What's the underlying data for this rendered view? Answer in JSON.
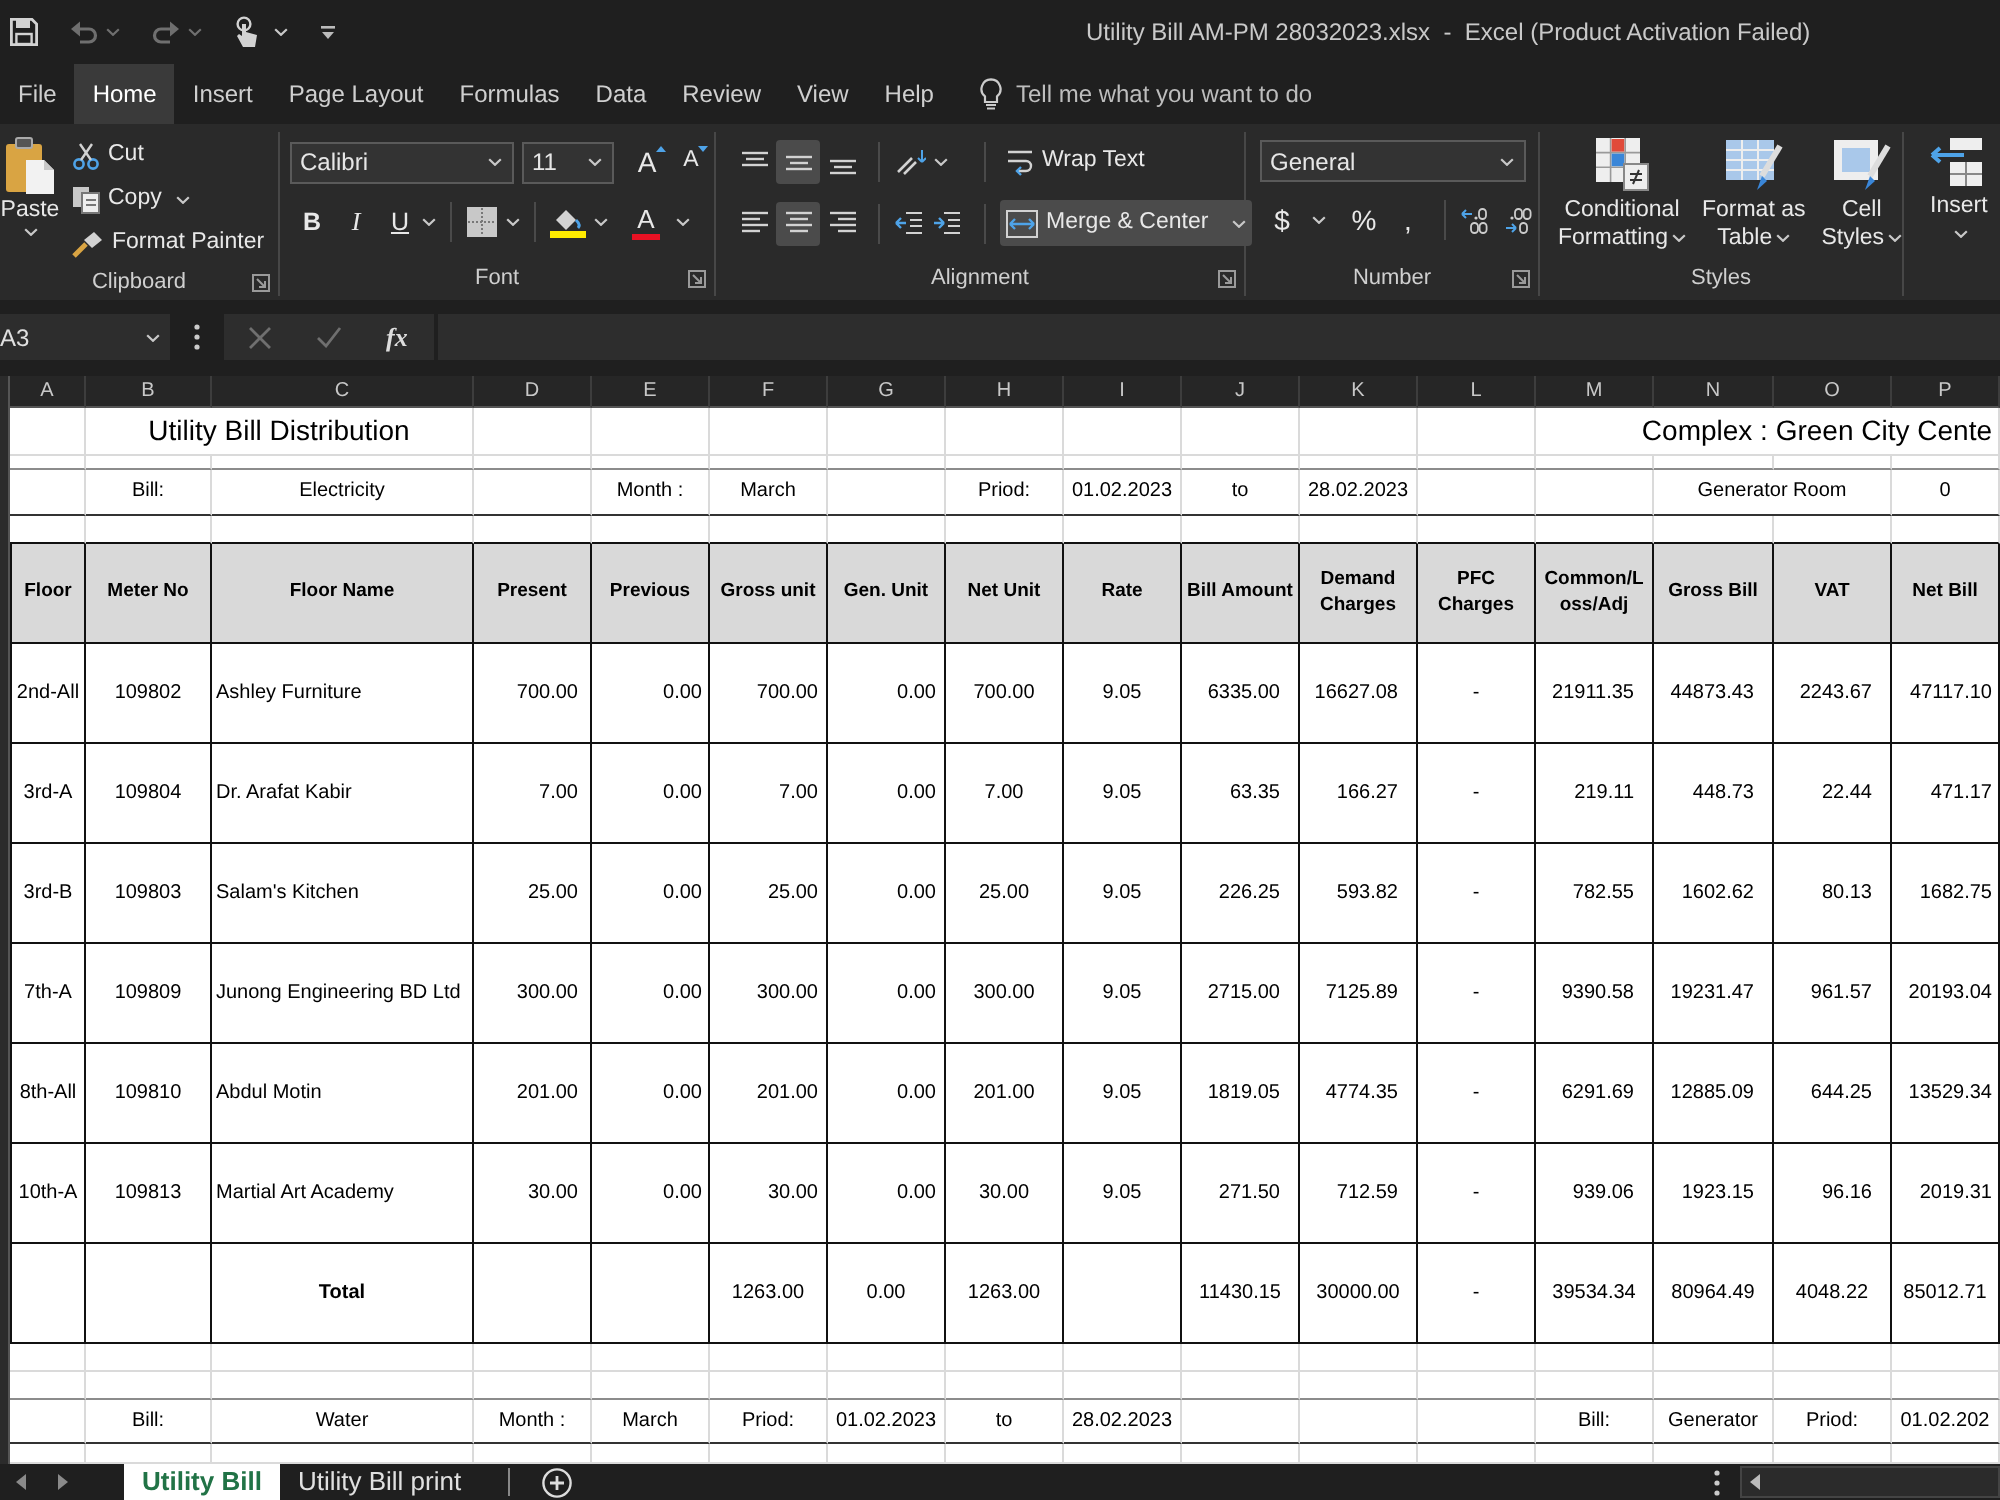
{
  "title_bar": {
    "title": "Utility Bill AM-PM 28032023.xlsx  -  Excel (Product Activation Failed)"
  },
  "menu_tabs": [
    {
      "label": "File",
      "selected": false
    },
    {
      "label": "Home",
      "selected": true
    },
    {
      "label": "Insert",
      "selected": false
    },
    {
      "label": "Page Layout",
      "selected": false
    },
    {
      "label": "Formulas",
      "selected": false
    },
    {
      "label": "Data",
      "selected": false
    },
    {
      "label": "Review",
      "selected": false
    },
    {
      "label": "View",
      "selected": false
    },
    {
      "label": "Help",
      "selected": false
    }
  ],
  "tell_me": {
    "placeholder": "Tell me what you want to do"
  },
  "ribbon": {
    "clipboard": {
      "label": "Clipboard",
      "paste": "Paste",
      "cut": "Cut",
      "copy": "Copy",
      "format_painter": "Format Painter"
    },
    "font": {
      "label": "Font",
      "font_name": "Calibri",
      "font_size": "11",
      "grow": "A",
      "shrink": "A",
      "bold": "B",
      "italic": "I",
      "underline": "U",
      "font_color": "A"
    },
    "alignment": {
      "label": "Alignment",
      "vertical": [
        {
          "selected": false
        },
        {
          "selected": true
        },
        {
          "selected": false
        }
      ],
      "horizontal": [
        {
          "selected": false
        },
        {
          "selected": true
        },
        {
          "selected": false
        }
      ],
      "wrap_text": "Wrap Text",
      "merge_center": {
        "label": "Merge & Center",
        "selected": true
      }
    },
    "number": {
      "label": "Number",
      "format": "General",
      "currency": "$",
      "percent": "%",
      "comma": ","
    },
    "styles": {
      "label": "Styles",
      "buttons": [
        {
          "lines": [
            "Conditional",
            "Formatting"
          ]
        },
        {
          "lines": [
            "Format as",
            "Table"
          ]
        },
        {
          "lines": [
            "Cell",
            "Styles"
          ]
        }
      ]
    },
    "cells": {
      "insert": "Insert"
    }
  },
  "formula_bar": {
    "name_box": "A3",
    "function_label": "fx"
  },
  "sheet": {
    "column_letters": [
      "A",
      "B",
      "C",
      "D",
      "E",
      "F",
      "G",
      "H",
      "I",
      "J",
      "K",
      "L",
      "M",
      "N",
      "O",
      "P"
    ],
    "title": "Utility Bill Distribution",
    "complex": "Complex : Green City Cente",
    "electricity_row": {
      "bill_label": "Bill:",
      "bill": "Electricity",
      "month_label": "Month :",
      "month": "March",
      "period_label": "Priod:",
      "from": "01.02.2023",
      "to_label": "to",
      "to": "28.02.2023",
      "generator_label": "Generator Room",
      "generator": "0"
    },
    "table": {
      "columns": [
        "Floor",
        "Meter No",
        "Floor Name",
        "Present",
        "Previous",
        "Gross unit",
        "Gen. Unit",
        "Net Unit",
        "Rate",
        "Bill Amount",
        "Demand Charges",
        "PFC Charges",
        "Common/Loss/Adj",
        "Gross Bill",
        "VAT",
        "Net Bill"
      ],
      "rows": [
        [
          "2nd-All",
          "109802",
          "Ashley Furniture",
          "700.00",
          "0.00",
          "700.00",
          "0.00",
          "700.00",
          "9.05",
          "6335.00",
          "16627.08",
          "-",
          "21911.35",
          "44873.43",
          "2243.67",
          "47117.10"
        ],
        [
          "3rd-A",
          "109804",
          "Dr. Arafat Kabir",
          "7.00",
          "0.00",
          "7.00",
          "0.00",
          "7.00",
          "9.05",
          "63.35",
          "166.27",
          "-",
          "219.11",
          "448.73",
          "22.44",
          "471.17"
        ],
        [
          "3rd-B",
          "109803",
          "Salam's Kitchen",
          "25.00",
          "0.00",
          "25.00",
          "0.00",
          "25.00",
          "9.05",
          "226.25",
          "593.82",
          "-",
          "782.55",
          "1602.62",
          "80.13",
          "1682.75"
        ],
        [
          "7th-A",
          "109809",
          "Junong Engineering BD Ltd",
          "300.00",
          "0.00",
          "300.00",
          "0.00",
          "300.00",
          "9.05",
          "2715.00",
          "7125.89",
          "-",
          "9390.58",
          "19231.47",
          "961.57",
          "20193.04"
        ],
        [
          "8th-All",
          "109810",
          "Abdul Motin",
          "201.00",
          "0.00",
          "201.00",
          "0.00",
          "201.00",
          "9.05",
          "1819.05",
          "4774.35",
          "-",
          "6291.69",
          "12885.09",
          "644.25",
          "13529.34"
        ],
        [
          "10th-A",
          "109813",
          "Martial Art Academy",
          "30.00",
          "0.00",
          "30.00",
          "0.00",
          "30.00",
          "9.05",
          "271.50",
          "712.59",
          "-",
          "939.06",
          "1923.15",
          "96.16",
          "2019.31"
        ]
      ],
      "total": {
        "label": "Total",
        "gross_unit": "1263.00",
        "gen_unit": "0.00",
        "net_unit": "1263.00",
        "bill_amount": "11430.15",
        "demand_charges": "30000.00",
        "pfc_charges": "-",
        "common_loss_adj": "39534.34",
        "gross_bill": "80964.49",
        "vat": "4048.22",
        "net_bill": "85012.71"
      }
    },
    "water_row": {
      "bill_label": "Bill:",
      "bill": "Water",
      "month_label": "Month :",
      "month": "March",
      "period_label": "Priod:",
      "from": "01.02.2023",
      "to_label": "to",
      "to": "28.02.2023",
      "bill2_label": "Bill:",
      "bill2": "Generator",
      "period2_label": "Priod:",
      "from2": "01.02.202"
    }
  },
  "sheet_tabs": [
    {
      "label": "Utility Bill",
      "selected": true
    },
    {
      "label": "Utility Bill print",
      "selected": false
    }
  ]
}
